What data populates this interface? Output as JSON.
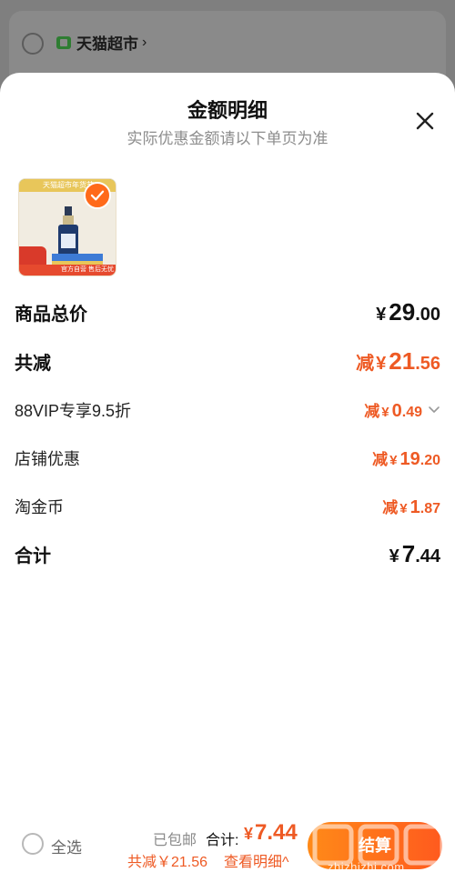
{
  "background": {
    "shop_name": "天猫超市",
    "shop_chevron": "›"
  },
  "sheet": {
    "title": "金额明细",
    "subtitle": "实际优惠金额请以下单页为准"
  },
  "product": {
    "image_top_text": "天猫超市年货节",
    "image_bottom_text": "官方自营 售后无忧"
  },
  "rows": {
    "total_price": {
      "label": "商品总价",
      "yen": "¥",
      "int": "29",
      "dec": ".00"
    },
    "total_discount": {
      "label": "共减",
      "prefix": "减",
      "yen": "¥",
      "int": "21",
      "dec": ".56"
    },
    "vip": {
      "label": "88VIP专享9.5折",
      "prefix": "减",
      "yen": "¥",
      "int": "0",
      "dec": ".49"
    },
    "shop": {
      "label": "店铺优惠",
      "prefix": "减",
      "yen": "¥",
      "int": "19",
      "dec": ".20"
    },
    "coins": {
      "label": "淘金币",
      "prefix": "减",
      "yen": "¥",
      "int": "1",
      "dec": ".87"
    },
    "sum": {
      "label": "合计",
      "yen": "¥",
      "int": "7",
      "dec": ".44"
    }
  },
  "bottom": {
    "select_all": "全选",
    "shipping": "已包邮",
    "total_label": "合计:",
    "total_yen": "¥",
    "total_value": "7.44",
    "saving": "共减￥21.56",
    "detail": "查看明细^",
    "settle": "结算"
  },
  "watermark": {
    "site": "zhizhizhi.com"
  },
  "colors": {
    "accent": "#ee5a24",
    "button_from": "#ff8a18",
    "button_to": "#ff5a1e"
  }
}
